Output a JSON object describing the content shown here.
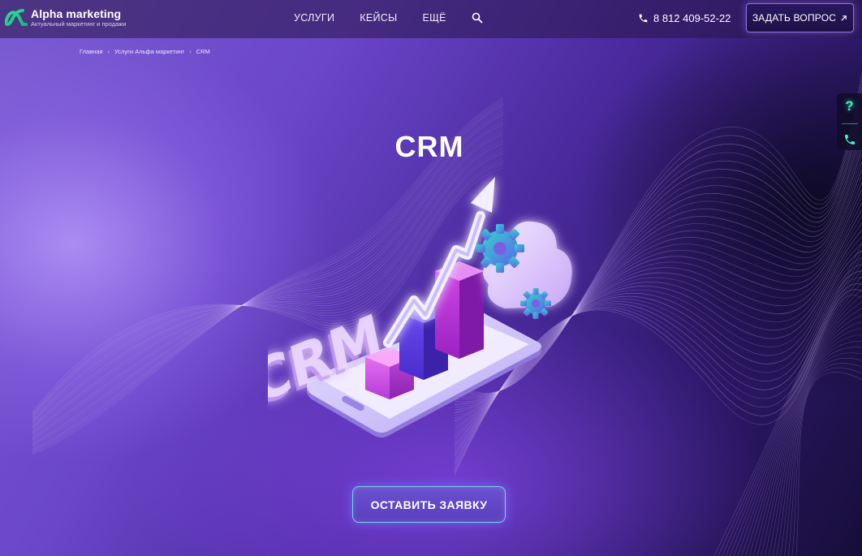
{
  "header": {
    "brand": "Alpha marketing",
    "tagline": "Актуальный маркетинг и продажи",
    "nav": [
      "УСЛУГИ",
      "КЕЙСЫ",
      "ЕЩЁ"
    ],
    "phone": "8 812 409-52-22",
    "ask_button": "ЗАДАТЬ ВОПРОС"
  },
  "breadcrumb": [
    "Главная",
    "Услуги Альфа маркетинг",
    "CRM"
  ],
  "side_widget": {
    "question": "?"
  },
  "hero": {
    "title": "CRM",
    "illustration_text": "CRM",
    "cta": "ОСТАВИТЬ ЗАЯВКУ"
  },
  "colors": {
    "accent_green": "#3ff0c0",
    "button_border": "#8b74f0",
    "cta_border": "#6fd9e6"
  },
  "icons": [
    "alpha-logo-icon",
    "search-icon",
    "phone-icon",
    "arrow-up-right-icon",
    "question-icon",
    "phone-call-icon"
  ]
}
